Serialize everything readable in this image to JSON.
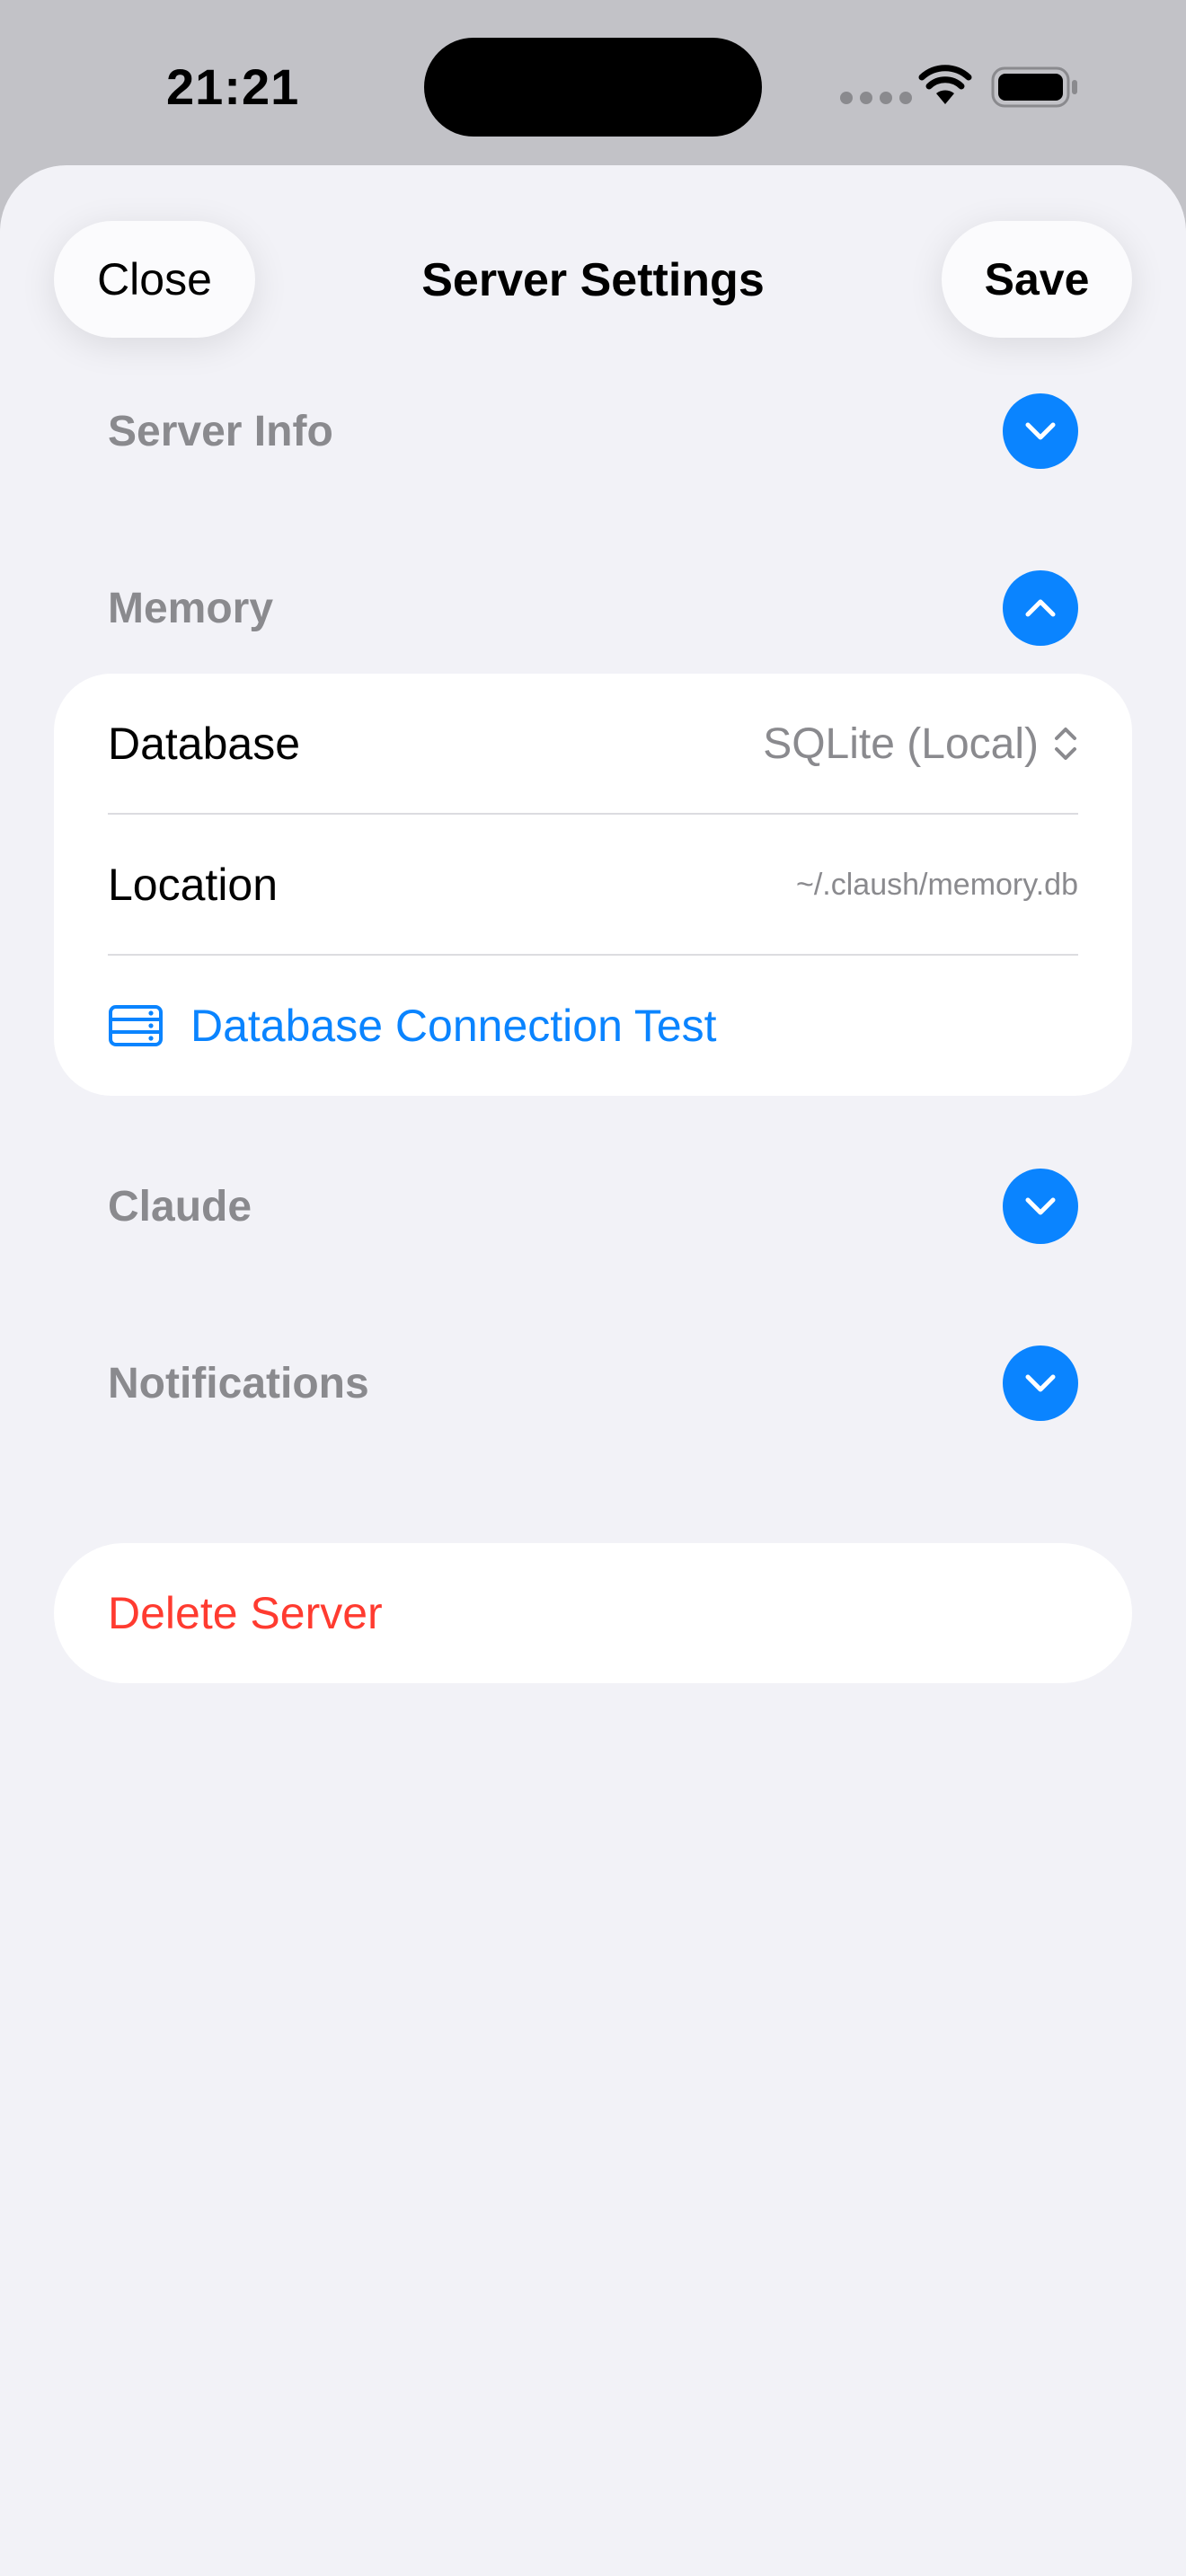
{
  "status_bar": {
    "time": "21:21"
  },
  "header": {
    "close_label": "Close",
    "title": "Server Settings",
    "save_label": "Save"
  },
  "sections": {
    "server_info": {
      "label": "Server Info",
      "state": "collapsed"
    },
    "memory": {
      "label": "Memory",
      "state": "expanded"
    },
    "claude": {
      "label": "Claude",
      "state": "collapsed"
    },
    "notifications": {
      "label": "Notifications",
      "state": "collapsed"
    }
  },
  "memory": {
    "database_label": "Database",
    "database_value": "SQLite (Local)",
    "location_label": "Location",
    "location_value": "~/.claush/memory.db",
    "test_label": "Database Connection Test"
  },
  "delete_label": "Delete Server",
  "colors": {
    "accent": "#0a84ff",
    "destructive": "#ff3b30",
    "secondary_text": "#8a8a8e",
    "background": "#f2f2f7"
  }
}
